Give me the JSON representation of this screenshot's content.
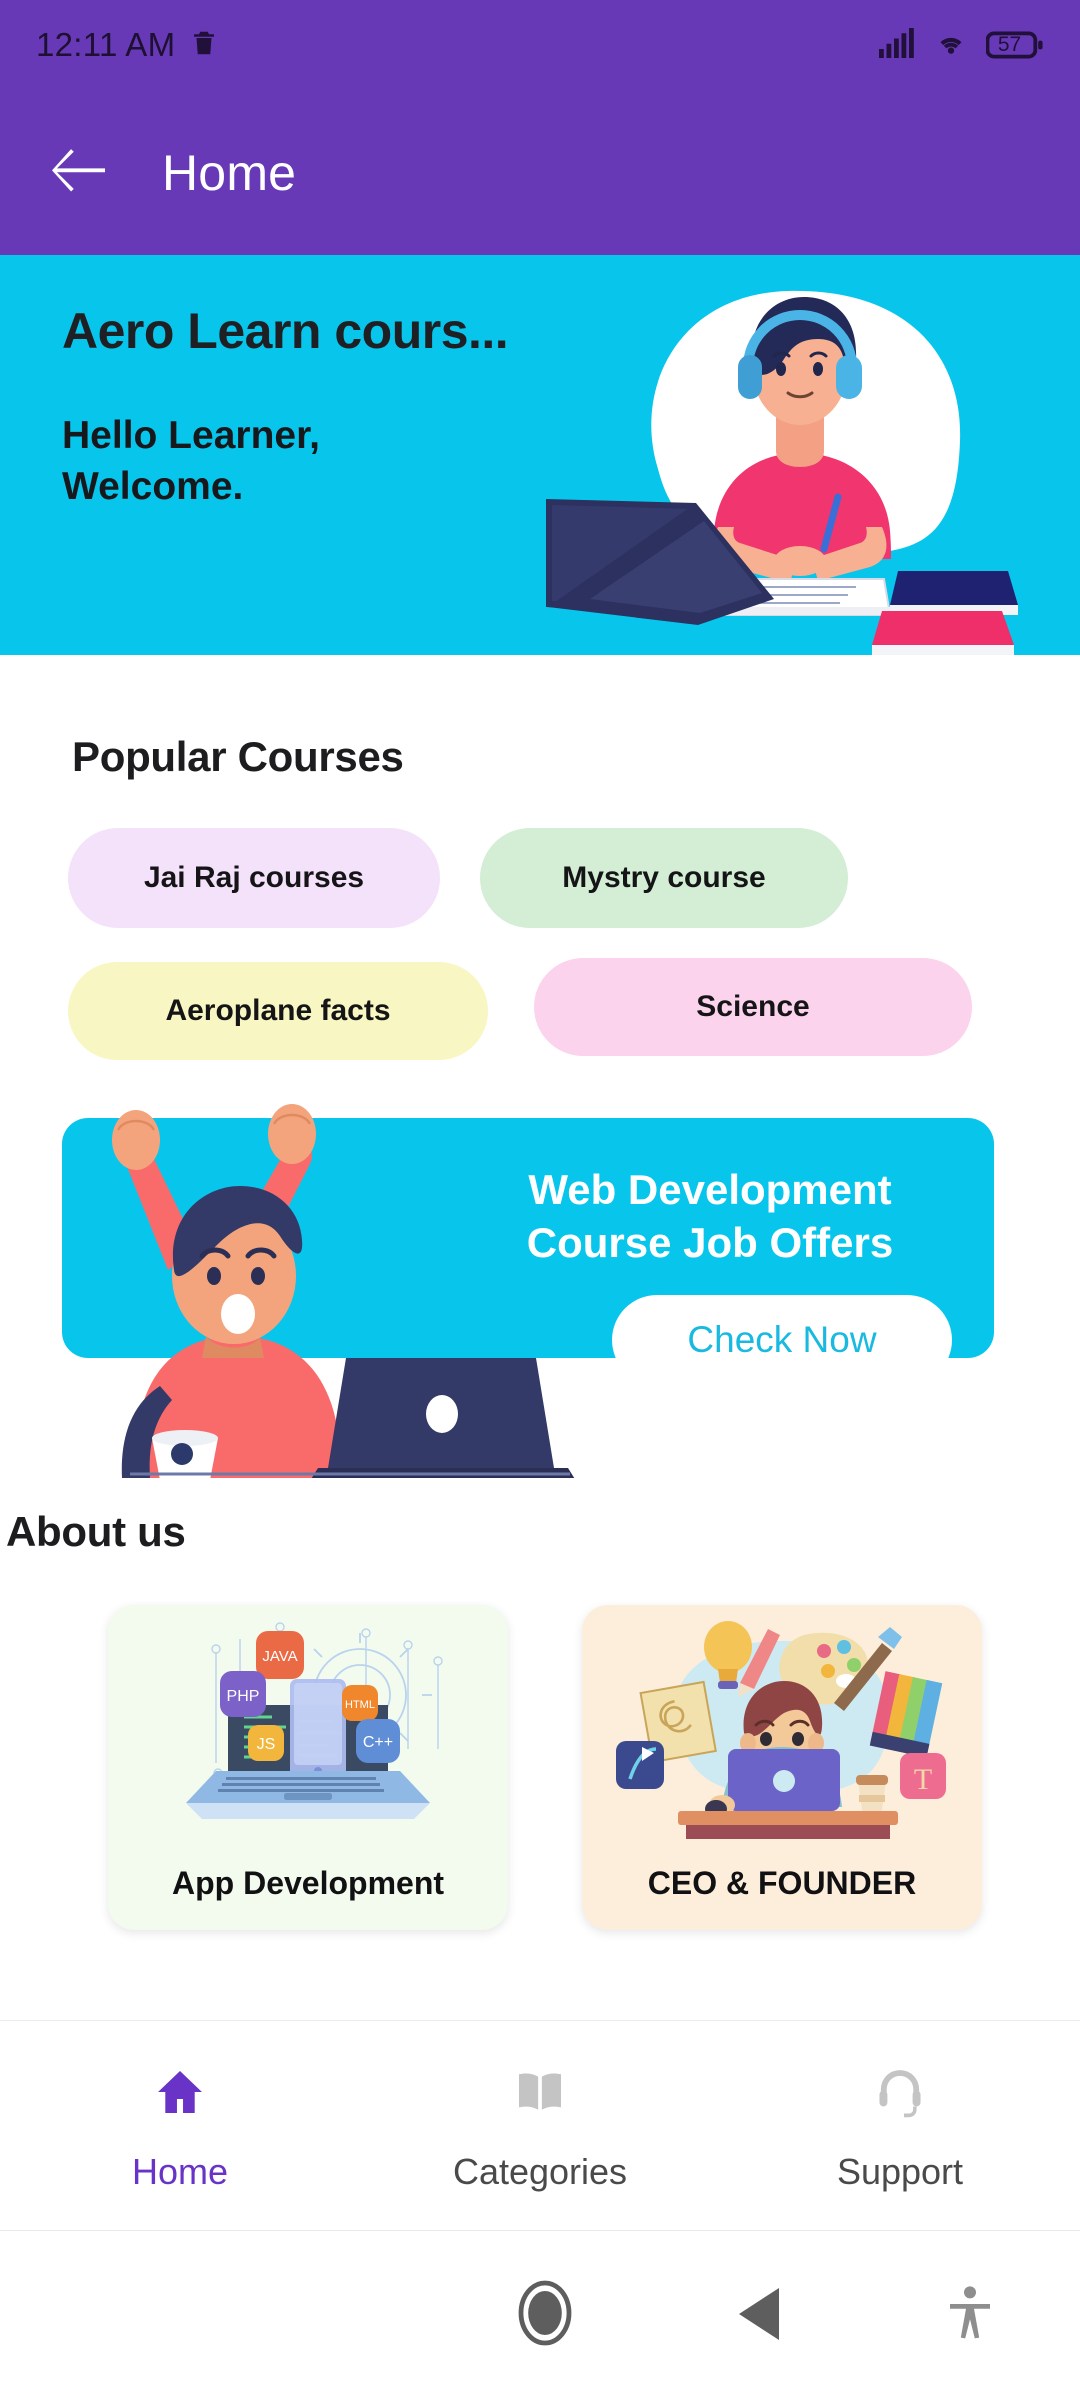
{
  "status_bar": {
    "time": "12:11 AM",
    "left_icon": "trash-icon",
    "signal_icon": "cellular-signal-icon",
    "wifi_icon": "wifi-icon",
    "battery_level": "57"
  },
  "app_bar": {
    "back_icon": "back-arrow-icon",
    "title": "Home"
  },
  "hero": {
    "title": "Aero Learn cours...",
    "greeting_line1": "Hello Learner,",
    "greeting_line2": "Welcome.",
    "background_color": "#08c5ec",
    "illustration": "student-with-headphones-studying-illustration"
  },
  "popular_courses": {
    "heading": "Popular Courses",
    "chips": [
      {
        "label": "Jai Raj courses",
        "color": "#f4e2fa"
      },
      {
        "label": "Mystry course",
        "color": "#d3eed5"
      },
      {
        "label": "Aeroplane facts",
        "color": "#f8f7c3"
      },
      {
        "label": "Science",
        "color": "#fbd3ec"
      }
    ]
  },
  "promo": {
    "title_line1": "Web Development",
    "title_line2": "Course Job Offers",
    "button_label": "Check Now",
    "background_color": "#08c5ec",
    "button_text_color": "#19b9e0",
    "illustration": "celebrating-man-with-laptop-illustration"
  },
  "about": {
    "heading": "About us",
    "cards": [
      {
        "label": "App Development",
        "color": "#f2fbee",
        "illustration": "laptop-with-programming-language-badges",
        "badges": [
          "JAVA",
          "PHP",
          "JS",
          "HTML",
          "C++"
        ]
      },
      {
        "label": "CEO & FOUNDER",
        "color": "#fdeedb",
        "illustration": "designer-at-laptop-with-creative-tools"
      }
    ]
  },
  "bottom_nav": {
    "active_color": "#6a33c7",
    "idle_color": "#4a4a4a",
    "items": [
      {
        "label": "Home",
        "icon": "home-icon",
        "active": true
      },
      {
        "label": "Categories",
        "icon": "book-icon",
        "active": false
      },
      {
        "label": "Support",
        "icon": "headset-icon",
        "active": false
      }
    ]
  },
  "system_nav": {
    "recents_icon": "recents-square-icon",
    "home_icon": "home-circle-icon",
    "back_icon": "back-triangle-icon",
    "accessibility_icon": "accessibility-icon"
  }
}
